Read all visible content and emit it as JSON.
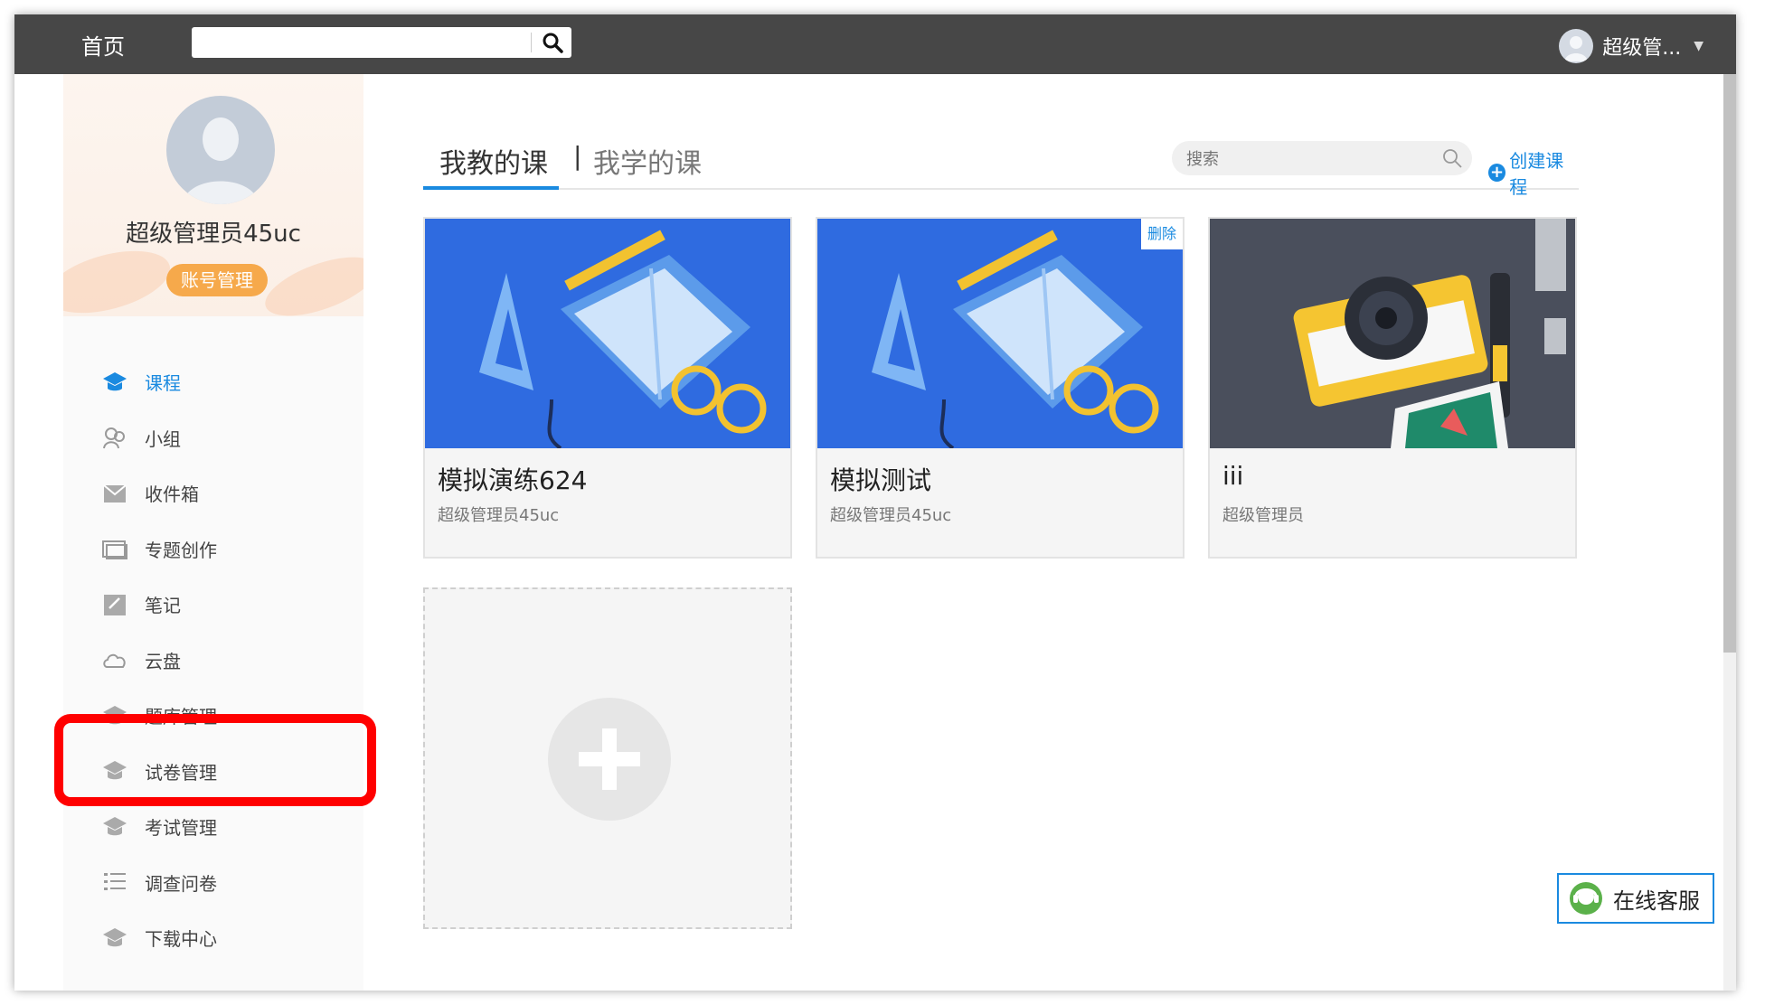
{
  "topbar": {
    "home_label": "首页",
    "search_value": "",
    "user_name": "超级管..."
  },
  "sidebar": {
    "profile_name": "超级管理员45uc",
    "account_button": "账号管理",
    "items": [
      {
        "label": "课程",
        "icon": "course-icon",
        "active": true
      },
      {
        "label": "小组",
        "icon": "group-icon"
      },
      {
        "label": "收件箱",
        "icon": "inbox-icon"
      },
      {
        "label": "专题创作",
        "icon": "topic-icon"
      },
      {
        "label": "笔记",
        "icon": "note-icon"
      },
      {
        "label": "云盘",
        "icon": "cloud-icon"
      },
      {
        "label": "题库管理",
        "icon": "question-bank-icon"
      },
      {
        "label": "试卷管理",
        "icon": "exam-paper-icon"
      },
      {
        "label": "考试管理",
        "icon": "exam-icon"
      },
      {
        "label": "调查问卷",
        "icon": "survey-icon"
      },
      {
        "label": "下载中心",
        "icon": "download-icon"
      }
    ]
  },
  "main": {
    "tabs": [
      {
        "label": "我教的课",
        "active": true
      },
      {
        "label": "我学的课",
        "active": false
      }
    ],
    "tab_separator": "|",
    "search_placeholder": "搜索",
    "create_label": "创建课程",
    "courses": [
      {
        "title": "模拟演练624",
        "author": "超级管理员45uc",
        "cover": "book-cover"
      },
      {
        "title": "模拟测试",
        "author": "超级管理员45uc",
        "cover": "book-cover",
        "badge": "删除"
      },
      {
        "title": "iii",
        "author": "超级管理员",
        "cover": "camera-cover"
      }
    ]
  },
  "service_label": "在线客服",
  "colors": {
    "topbar": "#474747",
    "accent": "#1a8ae0",
    "account_button": "#f6a94b",
    "highlight": "#ff0000"
  }
}
